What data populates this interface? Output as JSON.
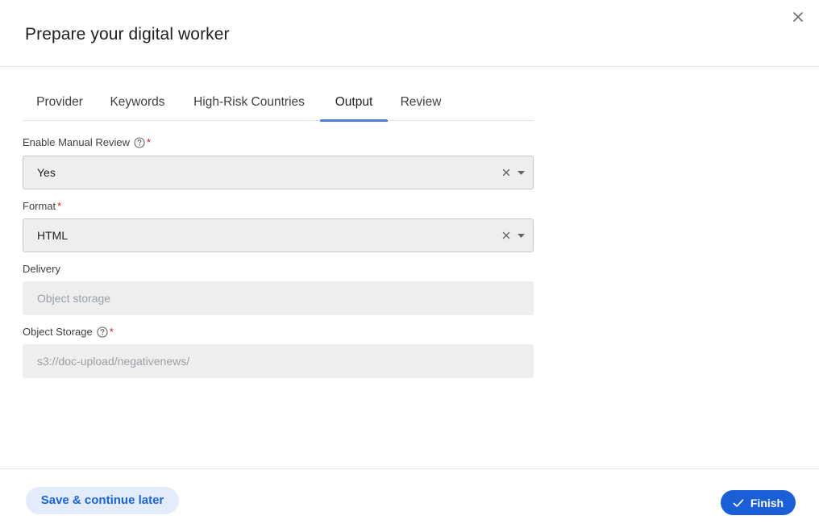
{
  "dialog": {
    "title": "Prepare your digital worker"
  },
  "tabs": [
    {
      "label": "Provider"
    },
    {
      "label": "Keywords"
    },
    {
      "label": "High-Risk Countries"
    },
    {
      "label": "Output"
    },
    {
      "label": "Review"
    }
  ],
  "active_tab": "Output",
  "fields": {
    "manual_review": {
      "label": "Enable Manual Review",
      "required_mark": "*",
      "value": "Yes"
    },
    "format": {
      "label": "Format",
      "required_mark": "*",
      "value": "HTML"
    },
    "delivery": {
      "label": "Delivery",
      "value": "Object storage"
    },
    "object_storage": {
      "label": "Object Storage",
      "required_mark": "*",
      "value": "s3://doc-upload/negativenews/"
    }
  },
  "footer": {
    "save_label": "Save & continue later",
    "finish_label": "Finish"
  },
  "icons": {
    "close": "close-icon",
    "help": "help-circle-icon",
    "clear": "clear-icon",
    "caret": "caret-down-icon",
    "check": "check-icon"
  },
  "colors": {
    "accent": "#1a5fd6",
    "tab_indicator": "#4a7fd8",
    "secondary_button_bg": "#e3ecfb",
    "required": "#c5221f"
  }
}
